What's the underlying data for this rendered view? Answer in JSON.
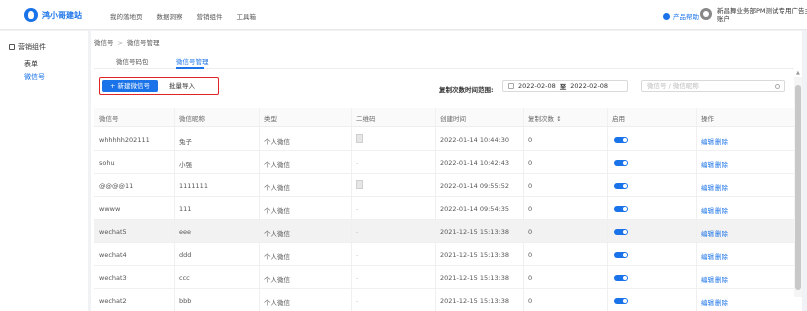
{
  "topbar": {
    "logo_text": "鸿小哥建站",
    "nav": [
      "我的落地页",
      "数据洞察",
      "营销组件",
      "工具箱"
    ],
    "help_label": "产品帮助",
    "user_name": "新昌舞业务部PM测试专用广告主账户"
  },
  "sidebar": {
    "section_title": "营销组件",
    "items": [
      {
        "label": "表单",
        "active": false
      },
      {
        "label": "微信号",
        "active": true
      }
    ]
  },
  "breadcrumb": [
    "微信号",
    "微信号管理"
  ],
  "tabs": [
    {
      "label": "微信号码包",
      "active": false
    },
    {
      "label": "微信号管理",
      "active": true
    }
  ],
  "actions": {
    "new_label": "+ 新建微信号",
    "import_label": "批量导入"
  },
  "filter": {
    "label": "复制次数时间范围:",
    "start_date": "2022-02-08",
    "to": "至",
    "end_date": "2022-02-08",
    "search_placeholder": "微信号 / 微信昵称"
  },
  "table": {
    "columns": [
      "微信号",
      "微信昵称",
      "类型",
      "二维码",
      "创建时间",
      "复制次数 ↕",
      "启用",
      "操作"
    ],
    "rows": [
      {
        "wechat_id": "whhhhh202111",
        "nickname": "兔子",
        "type": "个人微信",
        "qr": "image",
        "created": "2022-01-14 10:44:30",
        "copies": "0",
        "enabled": true,
        "highlight": false
      },
      {
        "wechat_id": "sohu",
        "nickname": "小强",
        "type": "个人微信",
        "qr": "-",
        "created": "2022-01-14 10:42:43",
        "copies": "0",
        "enabled": true,
        "highlight": false
      },
      {
        "wechat_id": "@@@@11",
        "nickname": "1111111",
        "type": "个人微信",
        "qr": "image",
        "created": "2022-01-14 09:55:52",
        "copies": "0",
        "enabled": true,
        "highlight": false
      },
      {
        "wechat_id": "wwww",
        "nickname": "111",
        "type": "个人微信",
        "qr": "-",
        "created": "2022-01-14 09:54:35",
        "copies": "0",
        "enabled": true,
        "highlight": false
      },
      {
        "wechat_id": "wechat5",
        "nickname": "eee",
        "type": "个人微信",
        "qr": "-",
        "created": "2021-12-15 15:13:38",
        "copies": "0",
        "enabled": true,
        "highlight": true
      },
      {
        "wechat_id": "wechat4",
        "nickname": "ddd",
        "type": "个人微信",
        "qr": "-",
        "created": "2021-12-15 15:13:38",
        "copies": "0",
        "enabled": true,
        "highlight": false
      },
      {
        "wechat_id": "wechat3",
        "nickname": "ccc",
        "type": "个人微信",
        "qr": "-",
        "created": "2021-12-15 15:13:38",
        "copies": "0",
        "enabled": true,
        "highlight": false
      },
      {
        "wechat_id": "wechat2",
        "nickname": "bbb",
        "type": "个人微信",
        "qr": "-",
        "created": "2021-12-15 15:13:38",
        "copies": "0",
        "enabled": true,
        "highlight": false
      }
    ],
    "edit_label": "编辑",
    "delete_label": "删除"
  },
  "colors": {
    "accent": "#1a73e8",
    "highlight_border": "#e02424"
  }
}
